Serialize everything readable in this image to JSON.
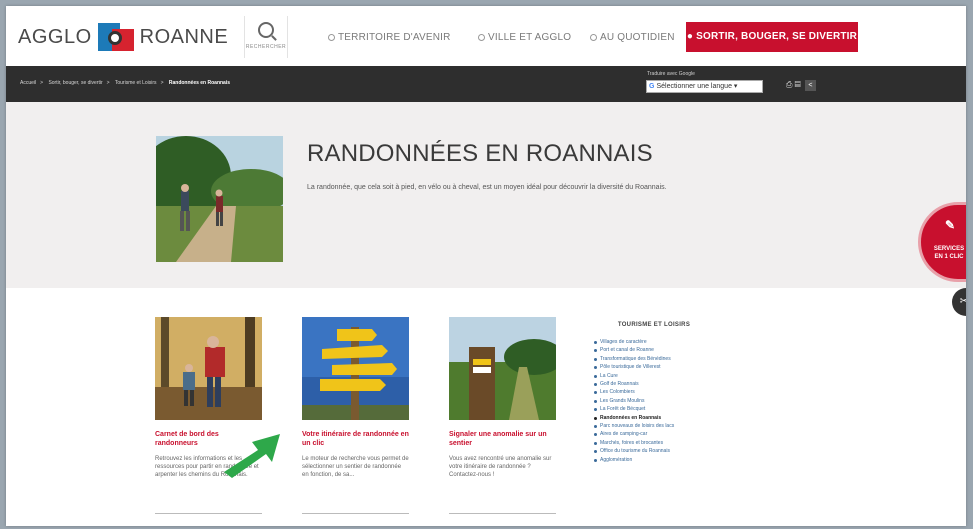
{
  "header": {
    "logo_left": "AGGLO",
    "logo_right": "ROANNE",
    "search_label": "RECHERCHER",
    "nav": [
      {
        "label": "TERRITOIRE D'AVENIR"
      },
      {
        "label": "VILLE ET AGGLO"
      },
      {
        "label": "AU QUOTIDIEN"
      }
    ],
    "nav_highlight": "SORTIR, BOUGER, SE DIVERTIR"
  },
  "breadcrumb": {
    "items": [
      "Accueil",
      "Sortir, bouger, se divertir",
      "Tourisme et Loisirs"
    ],
    "current": "Randonnées en Roannais",
    "separator": ">"
  },
  "translate": {
    "label": "Traduire avec Google",
    "select_value": "Sélectionner une langue"
  },
  "toolbar": {
    "print_icon": "print-icon",
    "pdf_icon": "pdf-icon",
    "share_icon": "share-icon"
  },
  "hero": {
    "title": "RANDONNÉES EN ROANNAIS",
    "description": "La randonnée, que cela soit à pied, en vélo ou à cheval, est un moyen idéal pour découvrir la diversité du Roannais."
  },
  "services": {
    "label_line1": "SERVICES",
    "label_line2": "EN 1 CLIC"
  },
  "cards": [
    {
      "title": "Carnet de bord des randonneurs",
      "text": "Retrouvez les informations et les ressources pour partir en randonnée et arpenter les chemins du Roannais."
    },
    {
      "title": "Votre itinéraire de randonnée en un clic",
      "text": "Le moteur de recherche vous permet de sélectionner un sentier de randonnée en fonction, de sa..."
    },
    {
      "title": "Signaler une anomalie sur un sentier",
      "text": "Vous avez rencontré une anomalie sur votre itinéraire de randonnée ? Contactez-nous !"
    }
  ],
  "sidebar": {
    "title": "TOURISME ET LOISIRS",
    "items": [
      "Villages de caractère",
      "Port et canal de Roanne",
      "Transformatique des Bénédines",
      "Pôle touristique de Villerest",
      "La Cure",
      "Golf de Roannais",
      "Les Colombiers",
      "Les Grands Moulins",
      "La Forêt de Bécquet",
      "Randonnées en Roannais",
      "Parc nouveaux de loisirs des lacs",
      "Aires de camping-car",
      "Marchés, foires et brocantes",
      "Office du tourisme du Roannais",
      "Agglomération"
    ],
    "active_index": 9
  },
  "colors": {
    "brand_red": "#c8102e",
    "dark_bar": "#2e2e2e",
    "hero_bg": "#f1efef",
    "arrow_green": "#2ea84a"
  }
}
